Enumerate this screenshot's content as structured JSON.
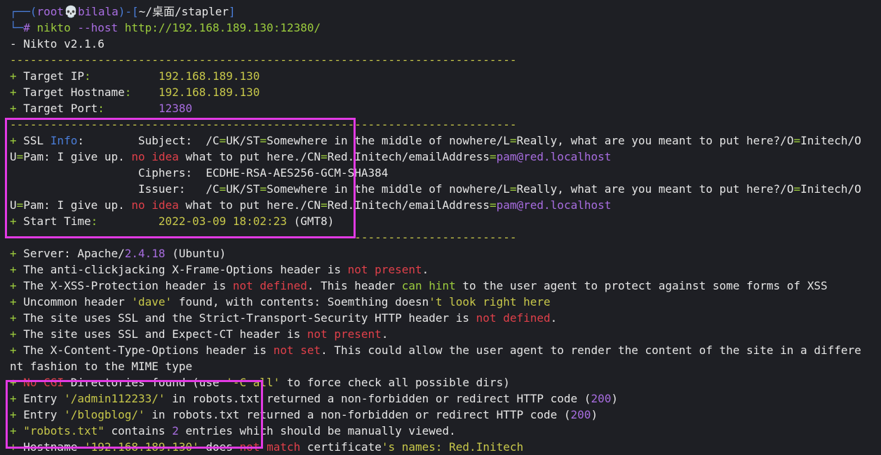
{
  "colors": {
    "background": "#1e1f24",
    "text": "#e6e6e6",
    "prompt_blue": "#4a7dd8",
    "purple": "#a86de0",
    "green": "#9ccc3d",
    "yellow": "#c8c84a",
    "red": "#e0404a",
    "highlight_box": "#e23ae3"
  },
  "lines": [
    [
      [
        "┌──(",
        "blue"
      ],
      [
        "root",
        "purple"
      ],
      [
        "💀",
        "default"
      ],
      [
        "bilala",
        "purple"
      ],
      [
        ")-[",
        "blue"
      ],
      [
        "~/桌面/stapler",
        "default"
      ],
      [
        "]",
        "blue"
      ]
    ],
    [
      [
        "└─",
        "blue"
      ],
      [
        "# ",
        "purple"
      ],
      [
        "nikto",
        "green"
      ],
      [
        " --host ",
        "purple"
      ],
      [
        "http://192.168.189.130:12380/",
        "green"
      ]
    ],
    [
      [
        "- Nikto v2.1.6",
        "default"
      ]
    ],
    [
      [
        "---------------------------------------------------------------------------",
        "yellow"
      ]
    ],
    [
      [
        "+ ",
        "green"
      ],
      [
        "Target IP",
        "default"
      ],
      [
        ":          ",
        "green"
      ],
      [
        "192.168.189.130",
        "yellow"
      ]
    ],
    [
      [
        "+ ",
        "green"
      ],
      [
        "Target Hostname",
        "default"
      ],
      [
        ":    ",
        "green"
      ],
      [
        "192.168.189.130",
        "yellow"
      ]
    ],
    [
      [
        "+ ",
        "green"
      ],
      [
        "Target Port",
        "default"
      ],
      [
        ":        ",
        "green"
      ],
      [
        "12380",
        "purple"
      ]
    ],
    [
      [
        "---------------------------------------------------------------------------",
        "yellow"
      ]
    ],
    [
      [
        "+ ",
        "green"
      ],
      [
        "SSL ",
        "default"
      ],
      [
        "Info",
        "blue"
      ],
      [
        ":        Subject:  /C",
        "default"
      ],
      [
        "=",
        "green"
      ],
      [
        "UK/ST",
        "default"
      ],
      [
        "=",
        "green"
      ],
      [
        "Somewhere in the middle of nowhere/L",
        "default"
      ],
      [
        "=",
        "green"
      ],
      [
        "Really, what are you meant to put here?/O",
        "default"
      ],
      [
        "=",
        "green"
      ],
      [
        "Initech/O",
        "default"
      ]
    ],
    [
      [
        "U",
        "default"
      ],
      [
        "=",
        "green"
      ],
      [
        "Pam: I give up. ",
        "default"
      ],
      [
        "no idea",
        "red"
      ],
      [
        " what to put here./CN",
        "default"
      ],
      [
        "=",
        "green"
      ],
      [
        "Red.Initech/emailAddress",
        "default"
      ],
      [
        "=",
        "green"
      ],
      [
        "pam@red.localhost",
        "purple"
      ]
    ],
    [
      [
        "                   Ciphers:  ECDHE-RSA-AES256-GCM-SHA384",
        "default"
      ]
    ],
    [
      [
        "                   Issuer:   /C",
        "default"
      ],
      [
        "=",
        "green"
      ],
      [
        "UK/ST",
        "default"
      ],
      [
        "=",
        "green"
      ],
      [
        "Somewhere in the middle of nowhere/L",
        "default"
      ],
      [
        "=",
        "green"
      ],
      [
        "Really, what are you meant to put here?/O",
        "default"
      ],
      [
        "=",
        "green"
      ],
      [
        "Initech/O",
        "default"
      ]
    ],
    [
      [
        "U",
        "default"
      ],
      [
        "=",
        "green"
      ],
      [
        "Pam: I give up. ",
        "default"
      ],
      [
        "no idea",
        "red"
      ],
      [
        " what to put here./CN",
        "default"
      ],
      [
        "=",
        "green"
      ],
      [
        "Red.Initech/emailAddress",
        "default"
      ],
      [
        "=",
        "green"
      ],
      [
        "pam@red.localhost",
        "purple"
      ]
    ],
    [
      [
        "+ ",
        "green"
      ],
      [
        "Start Time",
        "default"
      ],
      [
        ":         ",
        "green"
      ],
      [
        "2022-03-09 18:02:23",
        "yellow"
      ],
      [
        " (GMT8)",
        "default"
      ]
    ],
    [
      [
        "---------------------------------------------------------------------------",
        "yellow"
      ]
    ],
    [
      [
        "+ ",
        "green"
      ],
      [
        "Server: Apache/",
        "default"
      ],
      [
        "2.4.18",
        "purple"
      ],
      [
        " (Ubuntu)",
        "default"
      ]
    ],
    [
      [
        "+ ",
        "green"
      ],
      [
        "The anti-clickjacking X-Frame-Options header is ",
        "default"
      ],
      [
        "not present",
        "red"
      ],
      [
        ".",
        "default"
      ]
    ],
    [
      [
        "+ ",
        "green"
      ],
      [
        "The X-XSS-Protection header is ",
        "default"
      ],
      [
        "not defined",
        "red"
      ],
      [
        ". This header ",
        "default"
      ],
      [
        "can hint",
        "green"
      ],
      [
        " to the user agent to protect against some forms of XSS",
        "default"
      ]
    ],
    [
      [
        "+ ",
        "green"
      ],
      [
        "Uncommon header ",
        "default"
      ],
      [
        "'dave'",
        "yellow"
      ],
      [
        " found, with contents: Soemthing doesn",
        "default"
      ],
      [
        "'t look right here",
        "yellow"
      ]
    ],
    [
      [
        "+ ",
        "green"
      ],
      [
        "The site uses SSL and the Strict-Transport-Security HTTP header is ",
        "default"
      ],
      [
        "not defined",
        "red"
      ],
      [
        ".",
        "default"
      ]
    ],
    [
      [
        "+ ",
        "green"
      ],
      [
        "The site uses SSL and Expect-CT header is ",
        "default"
      ],
      [
        "not present",
        "red"
      ],
      [
        ".",
        "default"
      ]
    ],
    [
      [
        "+ ",
        "green"
      ],
      [
        "The X-Content-Type-Options header is ",
        "default"
      ],
      [
        "not set",
        "red"
      ],
      [
        ". This could allow the user agent to render the content of the site in a differe",
        "default"
      ]
    ],
    [
      [
        "nt fashion to the MIME type",
        "default"
      ]
    ],
    [
      [
        "+ ",
        "green"
      ],
      [
        "No CGI",
        "red"
      ],
      [
        " Directories found (use ",
        "default"
      ],
      [
        "'-C all'",
        "yellow"
      ],
      [
        " to force check all possible dirs)",
        "default"
      ]
    ],
    [
      [
        "+ ",
        "green"
      ],
      [
        "Entry ",
        "default"
      ],
      [
        "'/admin112233/'",
        "yellow"
      ],
      [
        " in robots.txt returned a non-forbidden or redirect HTTP code (",
        "default"
      ],
      [
        "200",
        "purple"
      ],
      [
        ")",
        "default"
      ]
    ],
    [
      [
        "+ ",
        "green"
      ],
      [
        "Entry ",
        "default"
      ],
      [
        "'/blogblog/'",
        "yellow"
      ],
      [
        " in robots.txt returned a non-forbidden or redirect HTTP code (",
        "default"
      ],
      [
        "200",
        "purple"
      ],
      [
        ")",
        "default"
      ]
    ],
    [
      [
        "+ ",
        "green"
      ],
      [
        "\"robots.txt\"",
        "yellow"
      ],
      [
        " contains ",
        "default"
      ],
      [
        "2",
        "purple"
      ],
      [
        " entries which should be manually viewed.",
        "default"
      ]
    ],
    [
      [
        "+ ",
        "green"
      ],
      [
        "Hostname ",
        "default"
      ],
      [
        "'192.168.189.130'",
        "yellow"
      ],
      [
        " does ",
        "default"
      ],
      [
        "not match",
        "red"
      ],
      [
        " certificate",
        "default"
      ],
      [
        "'s names: Red.Initech",
        "yellow"
      ]
    ]
  ]
}
